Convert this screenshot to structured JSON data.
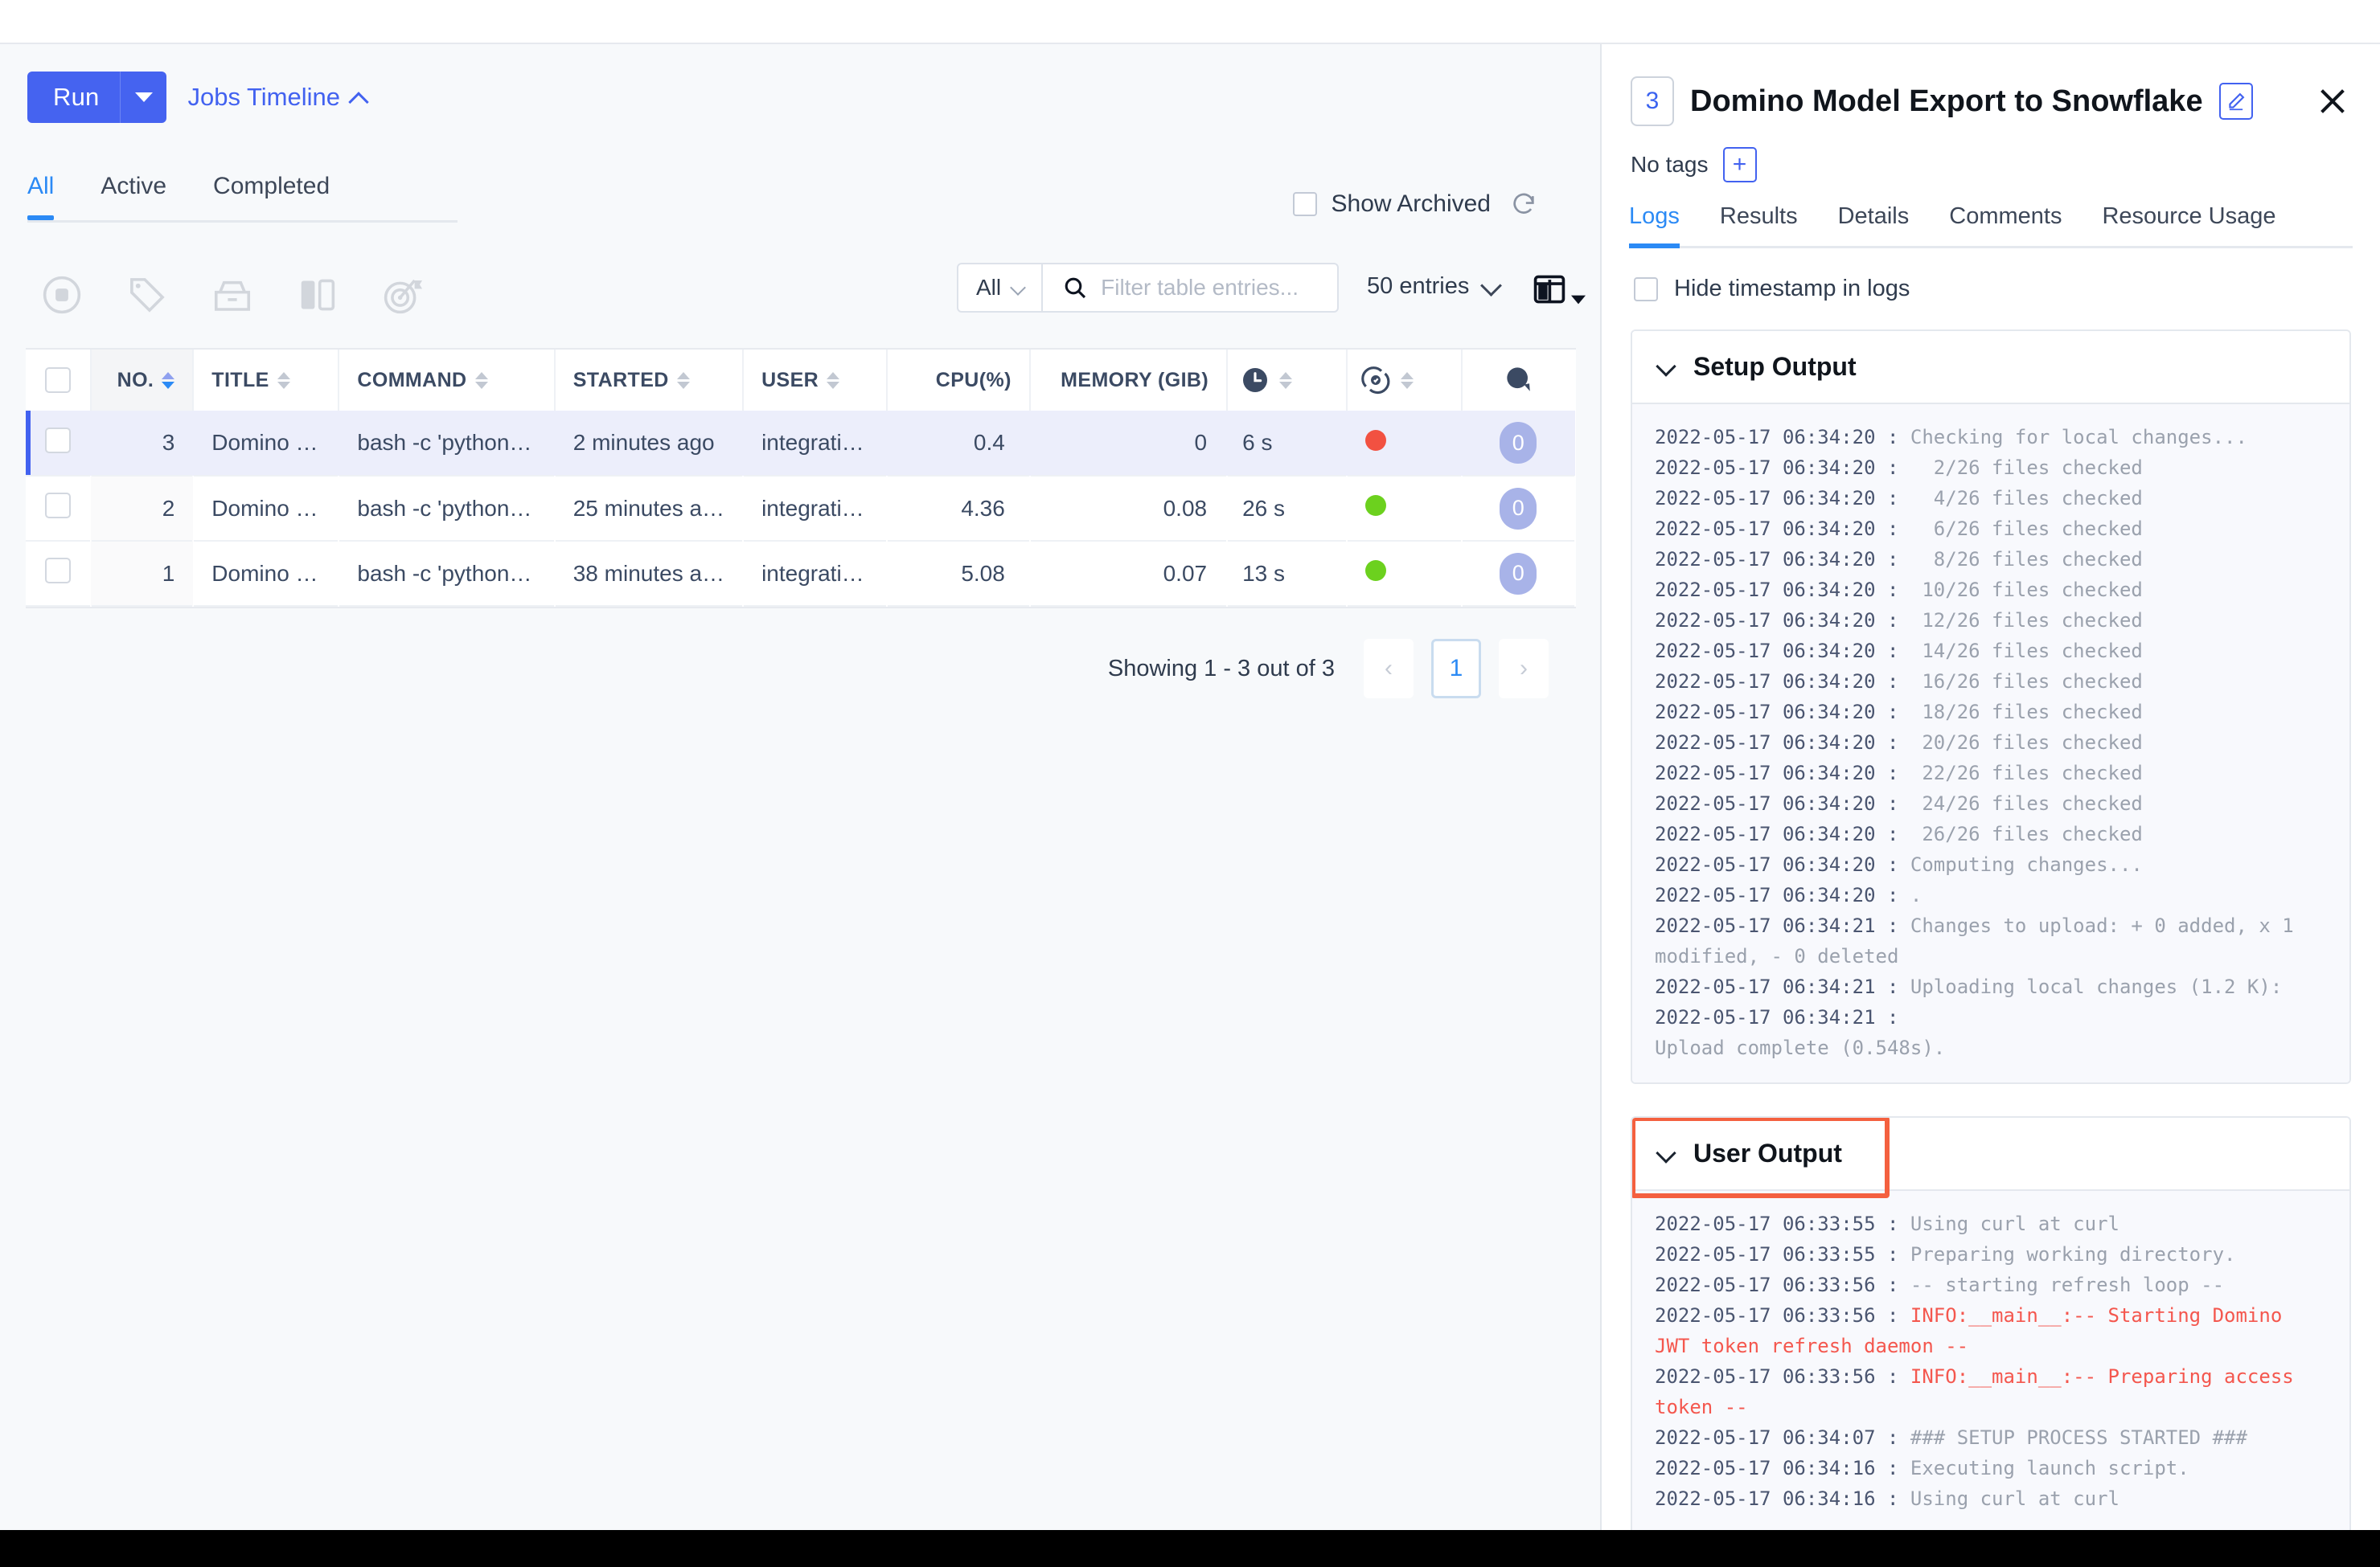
{
  "left": {
    "run_button": {
      "label": "Run"
    },
    "jobs_timeline": {
      "label": "Jobs Timeline"
    },
    "tabs": [
      {
        "label": "All",
        "active": true
      },
      {
        "label": "Active",
        "active": false
      },
      {
        "label": "Completed",
        "active": false
      }
    ],
    "show_archived": {
      "label": "Show Archived",
      "checked": false
    },
    "toolbar_icons": [
      "stop-circle-icon",
      "tag-icon",
      "archive-icon",
      "compare-columns-icon",
      "goal-target-icon"
    ],
    "filter": {
      "scope_label": "All",
      "search_placeholder": "Filter table entries...",
      "search_value": ""
    },
    "entries_select": {
      "label": "50 entries"
    },
    "columns_button": {
      "label": ""
    },
    "table": {
      "columns": [
        "NO.",
        "TITLE",
        "COMMAND",
        "STARTED",
        "USER",
        "CPU(%)",
        "MEMORY (GIB)",
        "",
        "",
        ""
      ],
      "rows": [
        {
          "no": "3",
          "title": "Domino …",
          "command": "bash -c 'python…",
          "started": "2 minutes ago",
          "user": "integrati…",
          "cpu": "0.4",
          "memory": "0",
          "duration": "6 s",
          "status_color": "#f25141",
          "comments": "0",
          "selected": true
        },
        {
          "no": "2",
          "title": "Domino …",
          "command": "bash -c 'python…",
          "started": "25 minutes a…",
          "user": "integrati…",
          "cpu": "4.36",
          "memory": "0.08",
          "duration": "26 s",
          "status_color": "#6cd11e",
          "comments": "0",
          "selected": false
        },
        {
          "no": "1",
          "title": "Domino …",
          "command": "bash -c 'python…",
          "started": "38 minutes a…",
          "user": "integrati…",
          "cpu": "5.08",
          "memory": "0.07",
          "duration": "13 s",
          "status_color": "#6cd11e",
          "comments": "0",
          "selected": false
        }
      ]
    },
    "pagination": {
      "showing": "Showing 1 - 3 out of 3",
      "prev": "‹",
      "current_page": "1",
      "next": "›"
    }
  },
  "right": {
    "job_number": "3",
    "title": "Domino Model Export to Snowflake",
    "tags_label": "No tags",
    "add_tag_label": "+",
    "tabs": [
      {
        "label": "Logs",
        "active": true
      },
      {
        "label": "Results",
        "active": false
      },
      {
        "label": "Details",
        "active": false
      },
      {
        "label": "Comments",
        "active": false
      },
      {
        "label": "Resource Usage",
        "active": false
      }
    ],
    "hide_timestamp": {
      "label": "Hide timestamp in logs",
      "checked": false
    },
    "setup_output": {
      "title": "Setup Output",
      "lines": [
        {
          "ts": "2022-05-17 06:34:20 : ",
          "msg": "Checking for local changes...",
          "err": false
        },
        {
          "ts": "2022-05-17 06:34:20 : ",
          "msg": "  2/26 files checked",
          "err": false
        },
        {
          "ts": "2022-05-17 06:34:20 : ",
          "msg": "  4/26 files checked",
          "err": false
        },
        {
          "ts": "2022-05-17 06:34:20 : ",
          "msg": "  6/26 files checked",
          "err": false
        },
        {
          "ts": "2022-05-17 06:34:20 : ",
          "msg": "  8/26 files checked",
          "err": false
        },
        {
          "ts": "2022-05-17 06:34:20 : ",
          "msg": " 10/26 files checked",
          "err": false
        },
        {
          "ts": "2022-05-17 06:34:20 : ",
          "msg": " 12/26 files checked",
          "err": false
        },
        {
          "ts": "2022-05-17 06:34:20 : ",
          "msg": " 14/26 files checked",
          "err": false
        },
        {
          "ts": "2022-05-17 06:34:20 : ",
          "msg": " 16/26 files checked",
          "err": false
        },
        {
          "ts": "2022-05-17 06:34:20 : ",
          "msg": " 18/26 files checked",
          "err": false
        },
        {
          "ts": "2022-05-17 06:34:20 : ",
          "msg": " 20/26 files checked",
          "err": false
        },
        {
          "ts": "2022-05-17 06:34:20 : ",
          "msg": " 22/26 files checked",
          "err": false
        },
        {
          "ts": "2022-05-17 06:34:20 : ",
          "msg": " 24/26 files checked",
          "err": false
        },
        {
          "ts": "2022-05-17 06:34:20 : ",
          "msg": " 26/26 files checked",
          "err": false
        },
        {
          "ts": "2022-05-17 06:34:20 : ",
          "msg": "Computing changes...",
          "err": false
        },
        {
          "ts": "2022-05-17 06:34:20 : ",
          "msg": ".",
          "err": false
        },
        {
          "ts": "2022-05-17 06:34:21 : ",
          "msg": "Changes to upload: + 0 added, x 1 modified, - 0 deleted",
          "err": false
        },
        {
          "ts": "2022-05-17 06:34:21 : ",
          "msg": "Uploading local changes (1.2 K):",
          "err": false
        },
        {
          "ts": "2022-05-17 06:34:21 : ",
          "msg": "\nUpload complete (0.548s).",
          "err": false
        }
      ]
    },
    "user_output": {
      "title": "User Output",
      "highlighted": true,
      "lines": [
        {
          "ts": "2022-05-17 06:33:55 : ",
          "msg": "Using curl at curl",
          "err": false
        },
        {
          "ts": "2022-05-17 06:33:55 : ",
          "msg": "Preparing working directory.",
          "err": false
        },
        {
          "ts": "2022-05-17 06:33:56 : ",
          "msg": "-- starting refresh loop --",
          "err": false
        },
        {
          "ts": "2022-05-17 06:33:56 : ",
          "msg": "INFO:__main__:-- Starting Domino JWT token refresh daemon --",
          "err": true
        },
        {
          "ts": "2022-05-17 06:33:56 : ",
          "msg": "INFO:__main__:-- Preparing access token --",
          "err": true
        },
        {
          "ts": "2022-05-17 06:34:07 : ",
          "msg": "### SETUP PROCESS STARTED ###",
          "err": false
        },
        {
          "ts": "2022-05-17 06:34:16 : ",
          "msg": "Executing launch script.",
          "err": false
        },
        {
          "ts": "2022-05-17 06:34:16 : ",
          "msg": "Using curl at curl",
          "err": false
        }
      ]
    }
  },
  "colors": {
    "brand_blue": "#4262f0",
    "tab_blue": "#2b8af5",
    "status_failed": "#f25141",
    "status_success": "#6cd11e",
    "highlight_red": "#f4603f",
    "log_error_red": "#f4574e"
  }
}
